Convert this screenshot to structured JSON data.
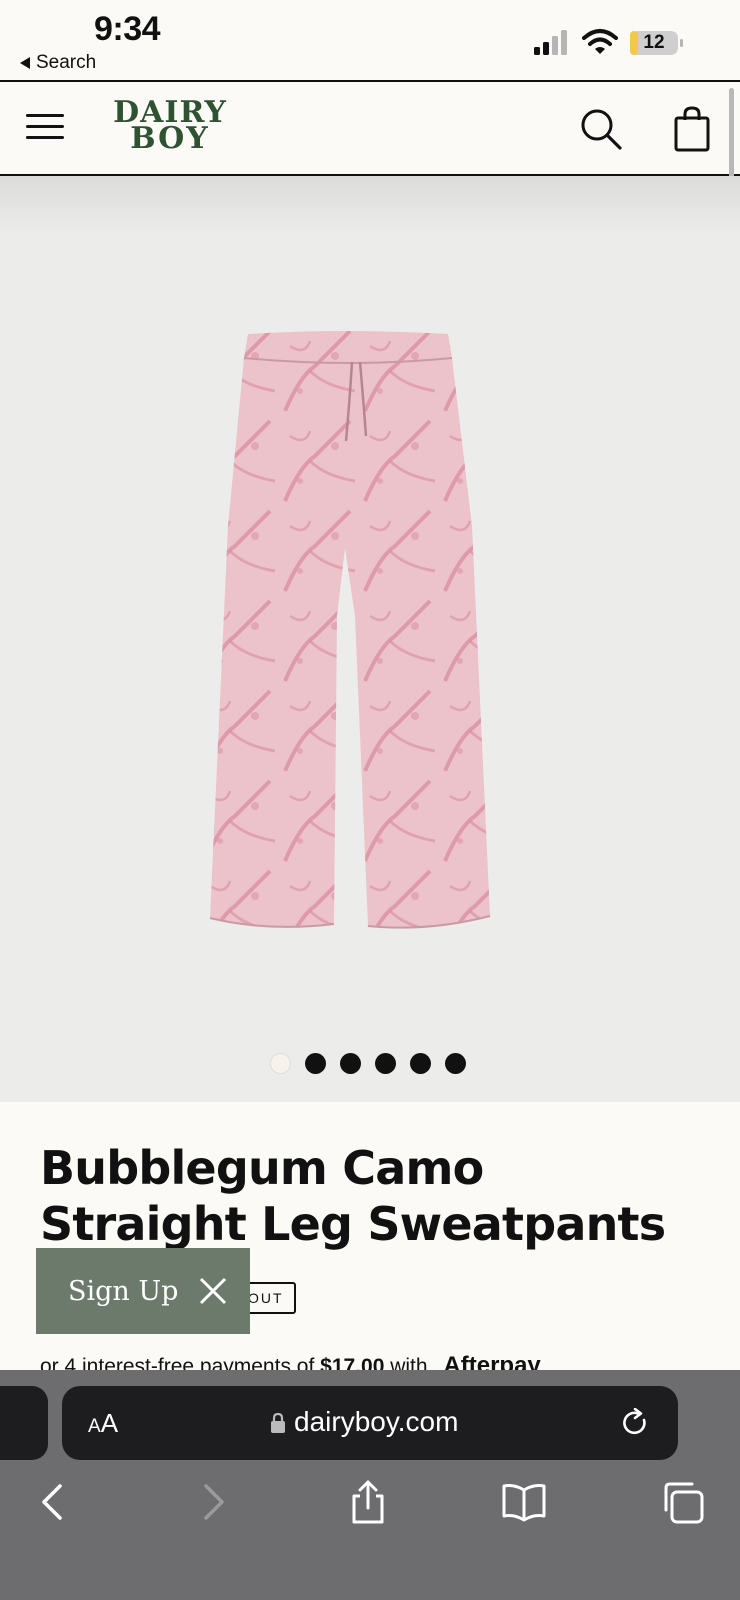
{
  "status_bar": {
    "time": "9:34",
    "back_label": "Search",
    "battery": "12"
  },
  "header": {
    "logo_line1": "DAIRY",
    "logo_line2": "BOY",
    "icons": [
      "menu-icon",
      "search-icon",
      "shopping-bag-icon"
    ]
  },
  "gallery": {
    "image": "pink camo sweatpants",
    "slide_count": 6,
    "active_slide": 1
  },
  "product": {
    "title": "Bubblegum Camo Straight Leg Sweatpants",
    "stock_badge": "OUT",
    "afterpay_prefix": "or 4 interest-free payments of ",
    "afterpay_amount": "$17.00",
    "afterpay_suffix": " with",
    "afterpay_brand": "Afterpay"
  },
  "signup_popup": {
    "label": "Sign Up"
  },
  "browser": {
    "aa_label_small": "A",
    "aa_label_large": "A",
    "domain": "dairyboy.com"
  },
  "colors": {
    "brand_green": "#2f5233",
    "signup_bg": "#6b7a6b",
    "pants_pink": "#e6b8c2",
    "camo_pink": "#d98aa0"
  }
}
